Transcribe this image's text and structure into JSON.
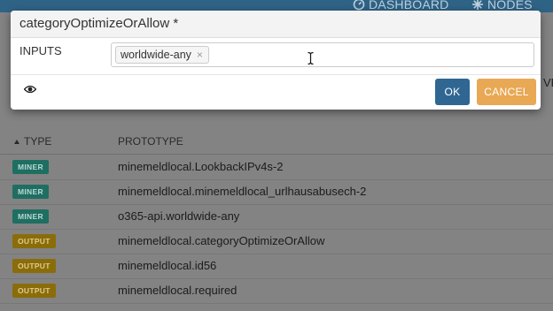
{
  "topnav": {
    "dashboard_label": "DASHBOARD",
    "nodes_label": "NODES"
  },
  "background": {
    "partial_header": "VE",
    "table": {
      "col_type": "TYPE",
      "col_prototype": "PROTOTYPE",
      "rows": [
        {
          "type": "MINER",
          "prototype": "minemeldlocal.LookbackIPv4s-2"
        },
        {
          "type": "MINER",
          "prototype": "minemeldlocal.minemeldlocal_urlhausabusech-2"
        },
        {
          "type": "MINER",
          "prototype": "o365-api.worldwide-any"
        },
        {
          "type": "OUTPUT",
          "prototype": "minemeldlocal.categoryOptimizeOrAllow"
        },
        {
          "type": "OUTPUT",
          "prototype": "minemeldlocal.id56"
        },
        {
          "type": "OUTPUT",
          "prototype": "minemeldlocal.required"
        }
      ]
    }
  },
  "modal": {
    "title": "categoryOptimizeOrAllow *",
    "inputs_label": "INPUTS",
    "tags": [
      "worldwide-any"
    ],
    "ok_label": "OK",
    "cancel_label": "CANCEL"
  },
  "colors": {
    "miner_badge": "#1f6e62",
    "output_badge": "#8a6d0a",
    "ok_button": "#2f6792",
    "cancel_button": "#e9a854"
  }
}
